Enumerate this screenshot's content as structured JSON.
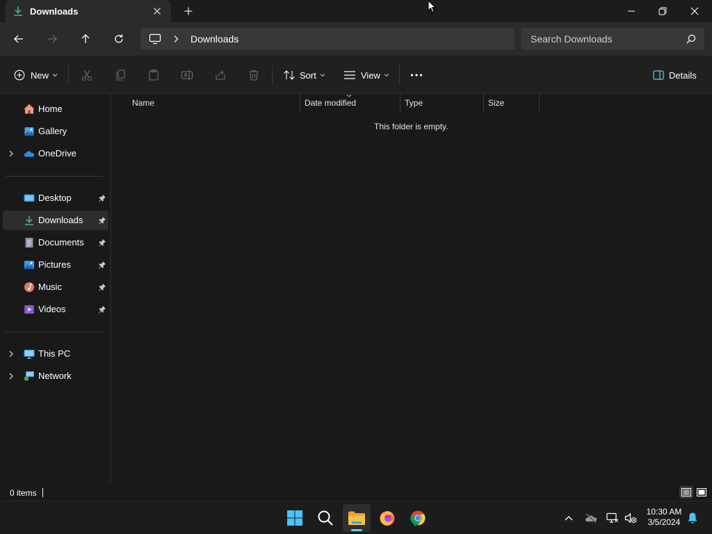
{
  "window": {
    "tab_title": "Downloads"
  },
  "navigation": {
    "breadcrumb": "Downloads",
    "search_placeholder": "Search Downloads"
  },
  "toolbar": {
    "new_label": "New",
    "sort_label": "Sort",
    "view_label": "View",
    "details_label": "Details"
  },
  "sidebar": {
    "quick": [
      {
        "label": "Home",
        "icon": "home-icon"
      },
      {
        "label": "Gallery",
        "icon": "gallery-icon"
      },
      {
        "label": "OneDrive",
        "icon": "onedrive-icon"
      }
    ],
    "pinned": [
      {
        "label": "Desktop",
        "icon": "desktop-folder-icon"
      },
      {
        "label": "Downloads",
        "icon": "downloads-folder-icon",
        "selected": true
      },
      {
        "label": "Documents",
        "icon": "documents-folder-icon"
      },
      {
        "label": "Pictures",
        "icon": "pictures-folder-icon"
      },
      {
        "label": "Music",
        "icon": "music-folder-icon"
      },
      {
        "label": "Videos",
        "icon": "videos-folder-icon"
      }
    ],
    "devices": [
      {
        "label": "This PC",
        "icon": "this-pc-icon"
      },
      {
        "label": "Network",
        "icon": "network-icon"
      }
    ]
  },
  "file_list": {
    "columns": [
      "Name",
      "Date modified",
      "Type",
      "Size"
    ],
    "empty_message": "This folder is empty."
  },
  "status": {
    "item_count": "0 items"
  },
  "taskbar": {
    "apps": [
      "start-icon",
      "search-icon",
      "file-explorer-icon",
      "firefox-icon",
      "chrome-icon"
    ],
    "clock_time": "10:30 AM",
    "clock_date": "3/5/2024"
  },
  "colors": {
    "accent": "#60cdff",
    "download_green": "#3fb37f",
    "folder_yellow": "#f5c242"
  }
}
